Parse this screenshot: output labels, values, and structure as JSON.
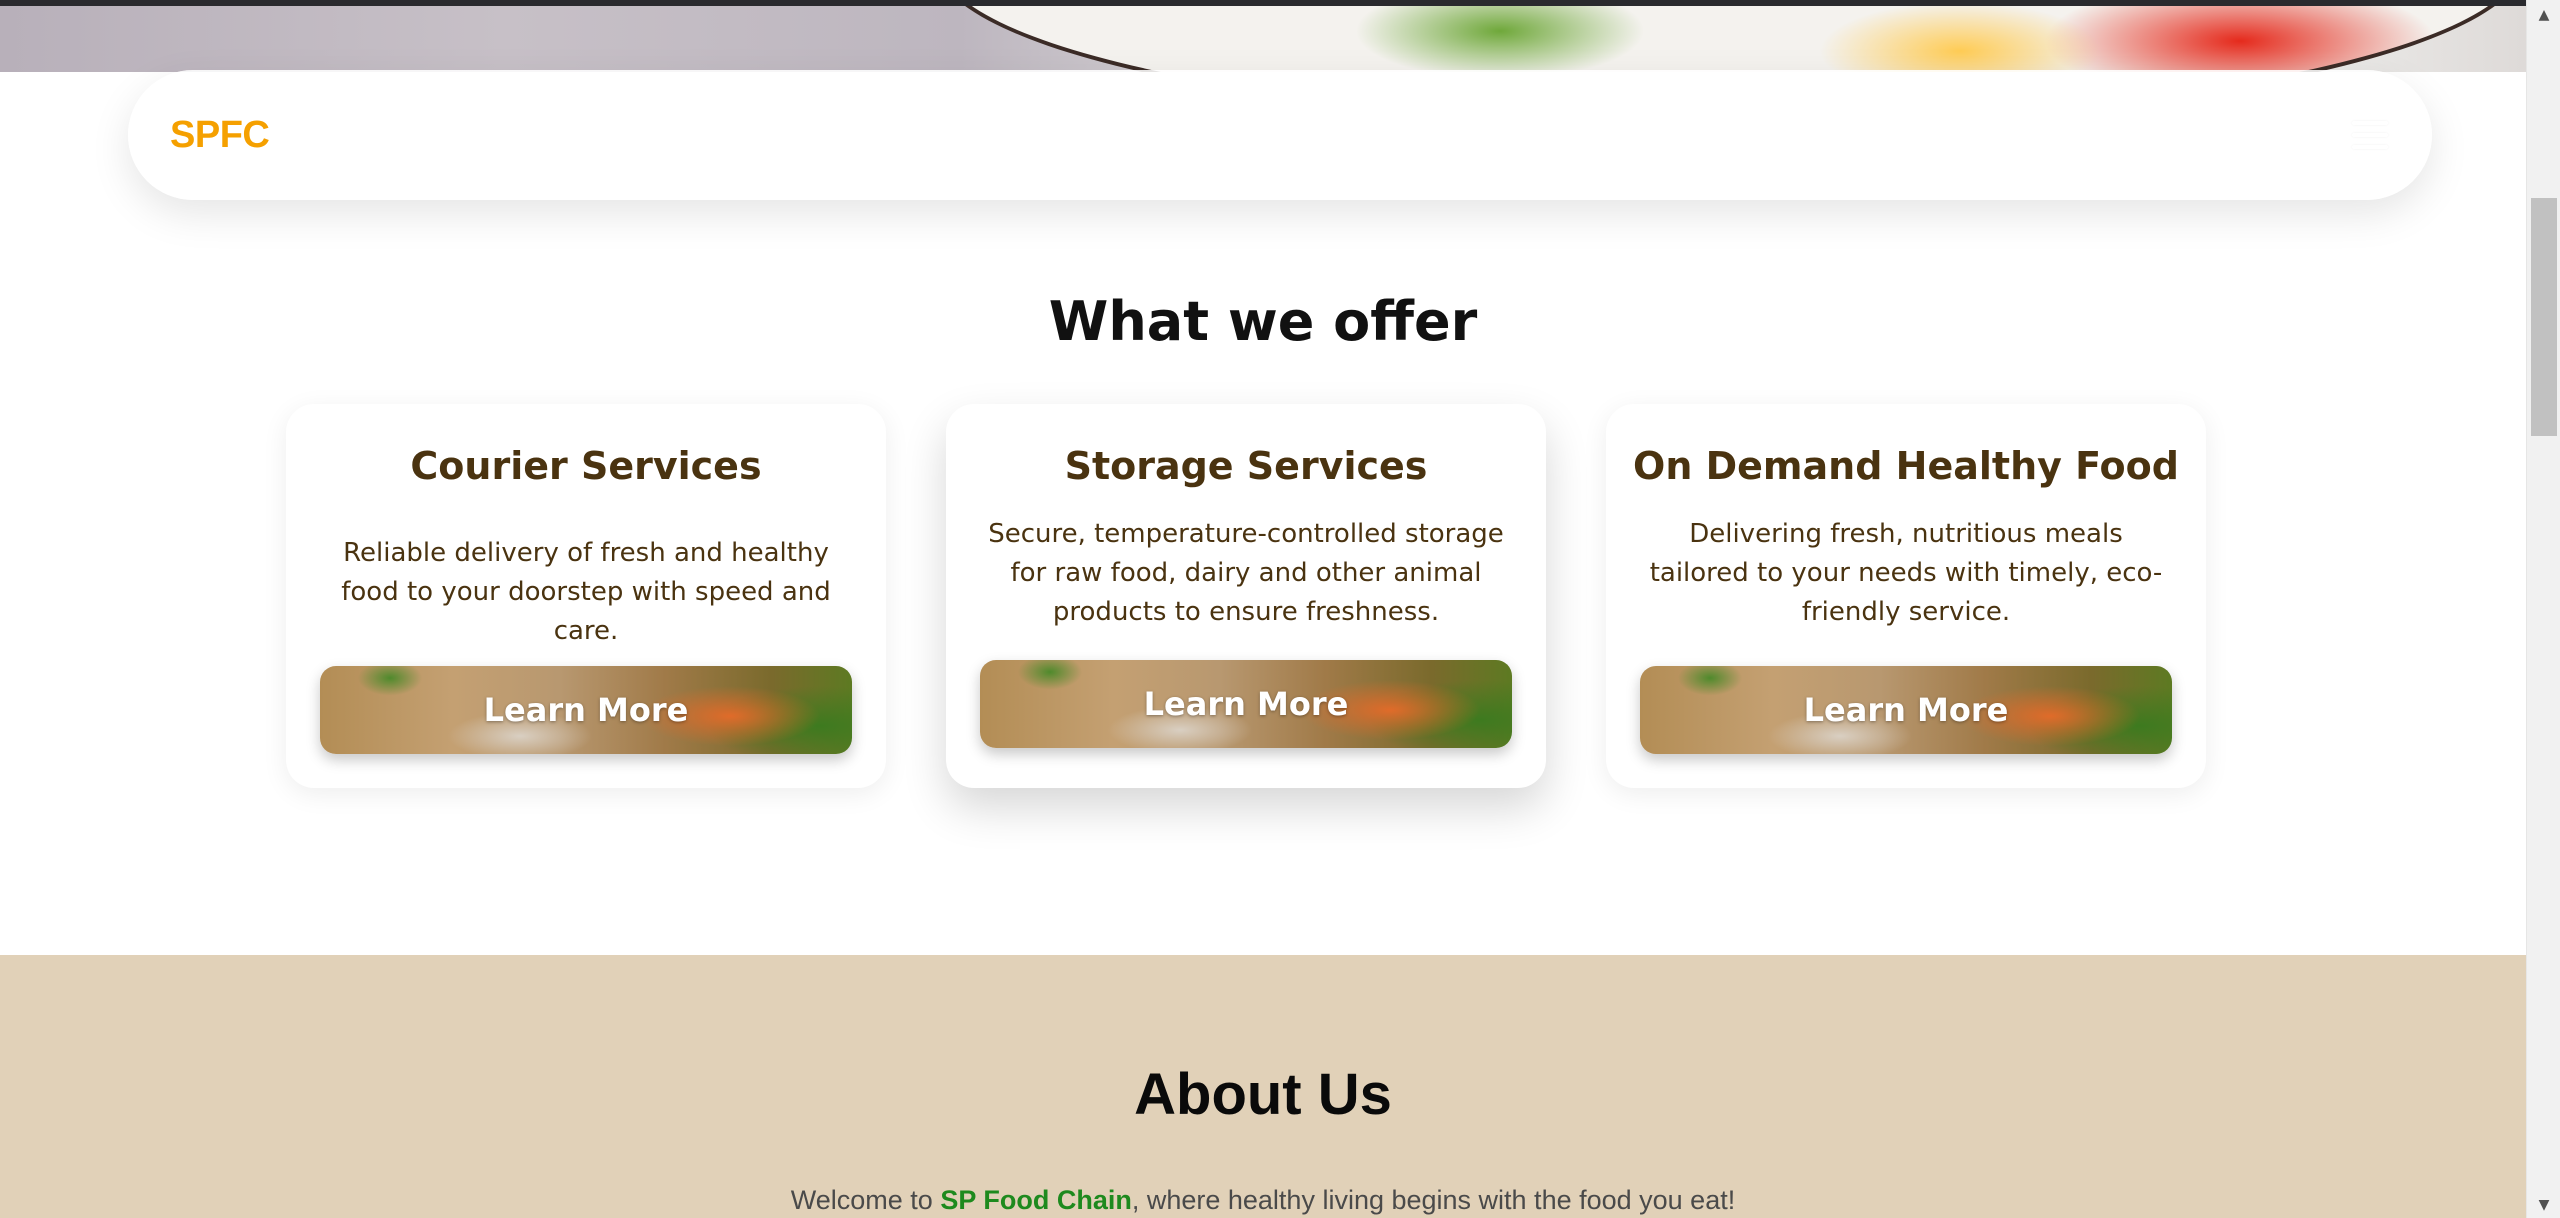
{
  "navbar": {
    "logo": "SPFC",
    "menu_icon": "hamburger-menu-icon"
  },
  "offer": {
    "title": "What we offer",
    "cards": [
      {
        "title": "Courier Services",
        "description": "Reliable delivery of fresh and healthy food to your doorstep with speed and care.",
        "button_label": "Learn More"
      },
      {
        "title": "Storage Services",
        "description": "Secure, temperature-controlled storage for raw food, dairy and other animal products to ensure freshness.",
        "button_label": "Learn More"
      },
      {
        "title": "On Demand Healthy Food",
        "description": "Delivering fresh, nutritious meals tailored to your needs with timely, eco-friendly service.",
        "button_label": "Learn More"
      }
    ]
  },
  "about": {
    "title": "About Us",
    "text_prefix": "Welcome to ",
    "brand": "SP Food Chain",
    "text_suffix": ", where healthy living begins with the food you eat!"
  },
  "colors": {
    "logo": "#f5a000",
    "card_text": "#4a3310",
    "about_bg": "#e1d1b8",
    "brand_green": "#1e8a1e"
  },
  "scrollbar": {
    "up_icon": "scroll-up-arrow-icon",
    "down_icon": "scroll-down-arrow-icon"
  }
}
